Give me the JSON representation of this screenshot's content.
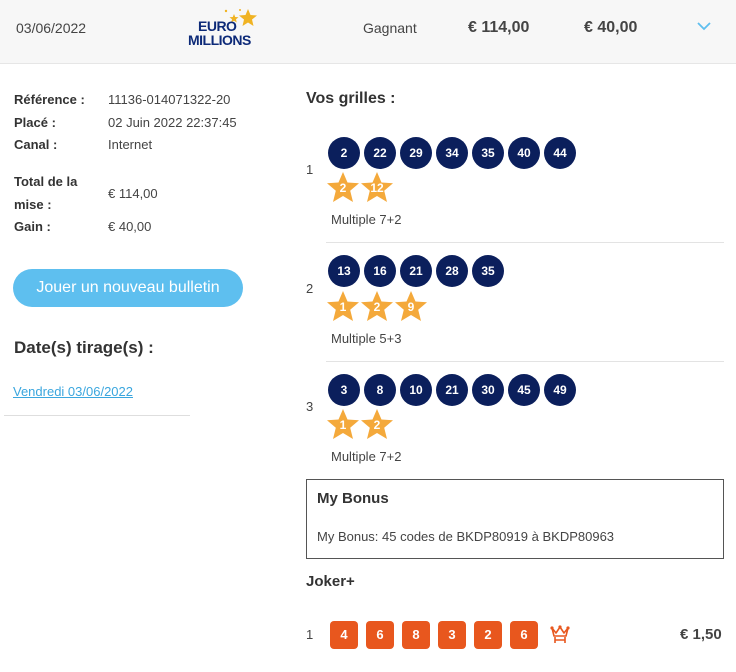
{
  "header": {
    "date": "03/06/2022",
    "logo_line1": "EURO",
    "logo_line2": "MILLIONS",
    "status": "Gagnant",
    "mise": "€ 114,00",
    "gain": "€ 40,00",
    "expand_icon": "chevron-down-icon",
    "colors": {
      "brand": "#0d2a78",
      "accent": "#5ebfef",
      "star": "#f4a93b"
    }
  },
  "details": {
    "reference_label": "Référence :",
    "reference_value": "11136-014071322-20",
    "place_label": "Placé :",
    "place_value": "02 Juin 2022 22:37:45",
    "canal_label": "Canal :",
    "canal_value": "Internet",
    "total_label_1": "Total de la",
    "total_label_2": "mise :",
    "total_value": "€ 114,00",
    "gain_label": "Gain :",
    "gain_value": "€ 40,00"
  },
  "play_button": "Jouer un nouveau bulletin",
  "dates_title": "Date(s) tirage(s) :",
  "date_link": "Vendredi 03/06/2022",
  "grids_title": "Vos grilles :",
  "grids": [
    {
      "num": "1",
      "balls": [
        "2",
        "22",
        "29",
        "34",
        "35",
        "40",
        "44"
      ],
      "stars": [
        "2",
        "12"
      ],
      "type": "Multiple 7+2"
    },
    {
      "num": "2",
      "balls": [
        "13",
        "16",
        "21",
        "28",
        "35"
      ],
      "stars": [
        "1",
        "2",
        "9"
      ],
      "type": "Multiple 5+3"
    },
    {
      "num": "3",
      "balls": [
        "3",
        "8",
        "10",
        "21",
        "30",
        "45",
        "49"
      ],
      "stars": [
        "1",
        "2"
      ],
      "type": "Multiple 7+2"
    }
  ],
  "bonus": {
    "title": "My Bonus",
    "text": "My Bonus: 45 codes de BKDP80919 à BKDP80963"
  },
  "joker": {
    "title": "Joker+",
    "num": "1",
    "digits": [
      "4",
      "6",
      "8",
      "3",
      "2",
      "6"
    ],
    "icon": "joker-jester-icon",
    "price": "€ 1,50"
  }
}
